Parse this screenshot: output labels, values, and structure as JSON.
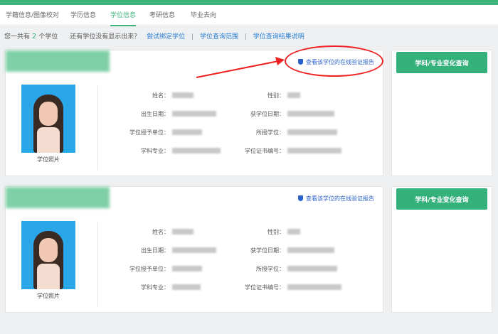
{
  "tabs": [
    {
      "label": "学籍信息/图像校对"
    },
    {
      "label": "学历信息"
    },
    {
      "label": "学位信息"
    },
    {
      "label": "考研信息"
    },
    {
      "label": "毕业去向"
    }
  ],
  "summary": {
    "prefix": "您一共有",
    "count": "2",
    "suffix": "个学位",
    "question": "还有学位没有显示出来？",
    "links": [
      "尝试绑定学位",
      "学位查询范围",
      "学位查询结果说明"
    ],
    "separator": "|"
  },
  "records": [
    {
      "verify_text": "查看该学位的在线验证报告",
      "photo_label": "学位照片",
      "fields": {
        "name": "姓名：",
        "gender": "性别：",
        "birth": "出生日期：",
        "degree_date": "获学位日期：",
        "grantor": "学位授予单位：",
        "degree": "所授学位：",
        "major": "学科专业：",
        "cert": "学位证书编号："
      },
      "side_button": "学科/专业变化查询"
    },
    {
      "verify_text": "查看该学位的在线验证报告",
      "photo_label": "学位照片",
      "fields": {
        "name": "姓名：",
        "gender": "性别：",
        "birth": "出生日期：",
        "degree_date": "获学位日期：",
        "grantor": "学位授予单位：",
        "degree": "所授学位：",
        "major": "学科专业：",
        "cert": "学位证书编号："
      },
      "side_button": "学科/专业变化查询"
    }
  ],
  "colors": {
    "accent": "#3cb37a",
    "link": "#2a7fd4",
    "annotation": "#e22222"
  }
}
